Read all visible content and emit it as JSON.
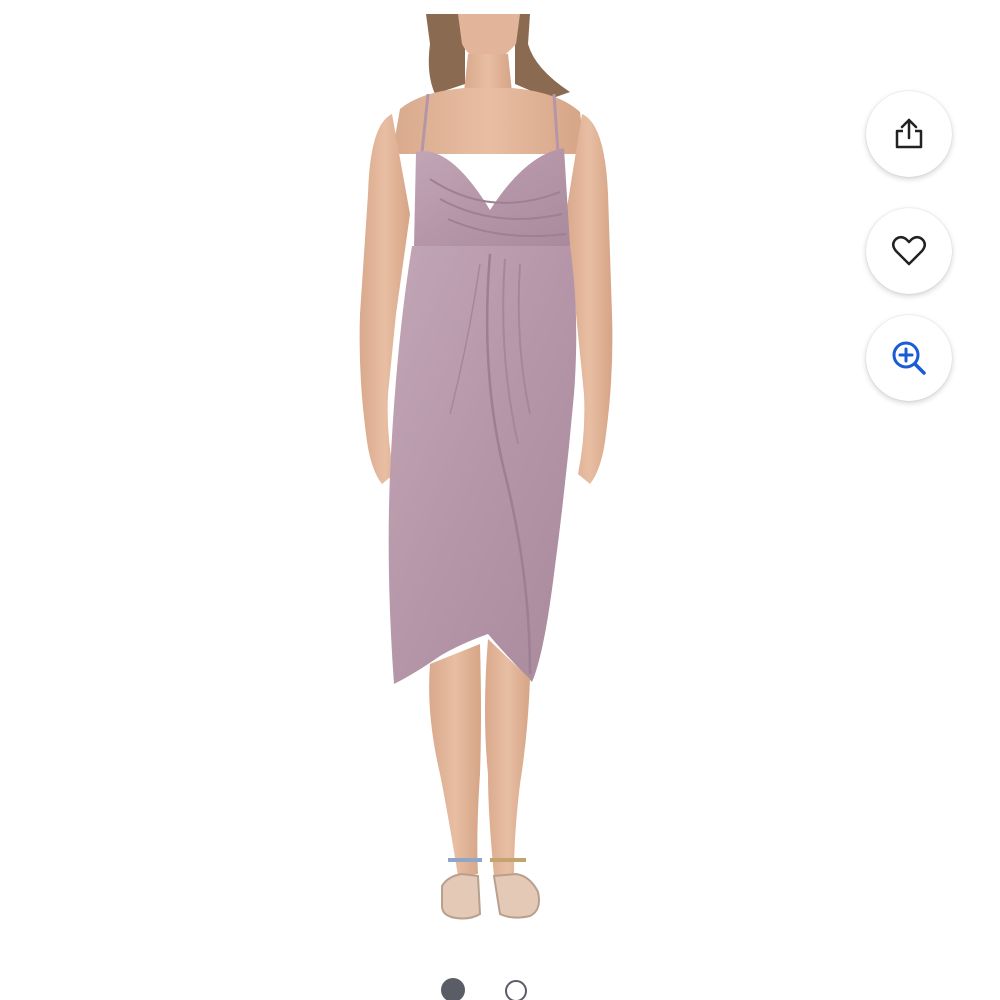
{
  "product": {
    "image_alt": "Woman wearing a sleeveless lilac metallic surplice wrap midi dress with tulip hem and strappy sandals",
    "dress_color": "#b79aaa",
    "skin_color": "#e3b79c",
    "hair_color": "#8a6a50"
  },
  "actions": {
    "share": {
      "label": "Share",
      "icon": "share-icon"
    },
    "favorite": {
      "label": "Favorite",
      "icon": "heart-icon"
    },
    "zoom": {
      "label": "Zoom",
      "icon": "zoom-in-icon",
      "color": "#1a5bd6"
    }
  },
  "carousel": {
    "total": 2,
    "current": 1,
    "dot_color": "#5a5d66"
  }
}
